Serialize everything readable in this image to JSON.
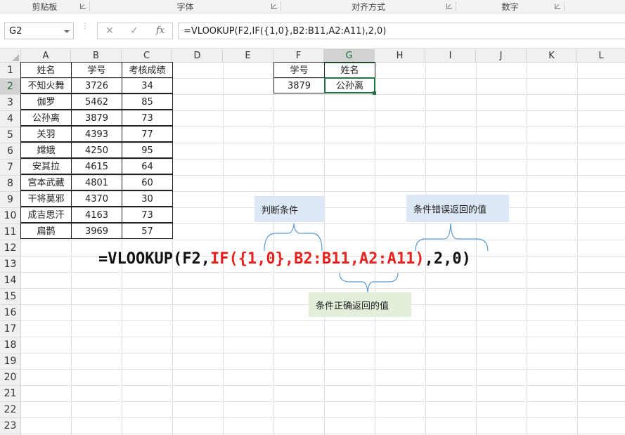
{
  "ribbon": {
    "groups": [
      {
        "label": "剪贴板"
      },
      {
        "label": "字体"
      },
      {
        "label": "对齐方式"
      },
      {
        "label": "数字"
      }
    ]
  },
  "formula_bar": {
    "name_box": "G2",
    "cancel_icon": "✕",
    "confirm_icon": "✓",
    "fx_label": "fx",
    "formula": "=VLOOKUP(F2,IF({1,0},B2:B11,A2:A11),2,0)"
  },
  "columns": [
    "A",
    "B",
    "C",
    "D",
    "E",
    "F",
    "G",
    "H",
    "I",
    "J",
    "K",
    "L"
  ],
  "selected_column": "G",
  "rows": [
    "1",
    "2",
    "3",
    "4",
    "5",
    "6",
    "7",
    "8",
    "9",
    "10",
    "11",
    "12",
    "13",
    "14",
    "15",
    "16",
    "17",
    "18",
    "19",
    "20",
    "21",
    "22",
    "23"
  ],
  "selected_row": "2",
  "table": {
    "headers": [
      "姓名",
      "学号",
      "考核成绩"
    ],
    "rows": [
      [
        "不知火舞",
        "3726",
        "34"
      ],
      [
        "伽罗",
        "5462",
        "85"
      ],
      [
        "公孙离",
        "3879",
        "73"
      ],
      [
        "关羽",
        "4393",
        "77"
      ],
      [
        "嫦娥",
        "4250",
        "95"
      ],
      [
        "安其拉",
        "4615",
        "64"
      ],
      [
        "宫本武藏",
        "4801",
        "60"
      ],
      [
        "干将莫邪",
        "4370",
        "30"
      ],
      [
        "成吉思汗",
        "4163",
        "73"
      ],
      [
        "扁鹊",
        "3969",
        "57"
      ]
    ]
  },
  "lookup": {
    "header_f": "学号",
    "header_g": "姓名",
    "value_f": "3879",
    "value_g": "公孙离"
  },
  "annotation": {
    "part1": "=VLOOKUP(F2,",
    "part2": "IF({1,0},B2:B11,A2:A11)",
    "part3": ",2,0)",
    "note_condition": "判断条件",
    "note_false": "条件错误返回的值",
    "note_true": "条件正确返回的值",
    "colors": {
      "red": "#e8201e",
      "note_blue": "#dce8f5",
      "note_green": "#e2efda",
      "brace": "#5b9bd5",
      "excel_green": "#217346"
    }
  }
}
